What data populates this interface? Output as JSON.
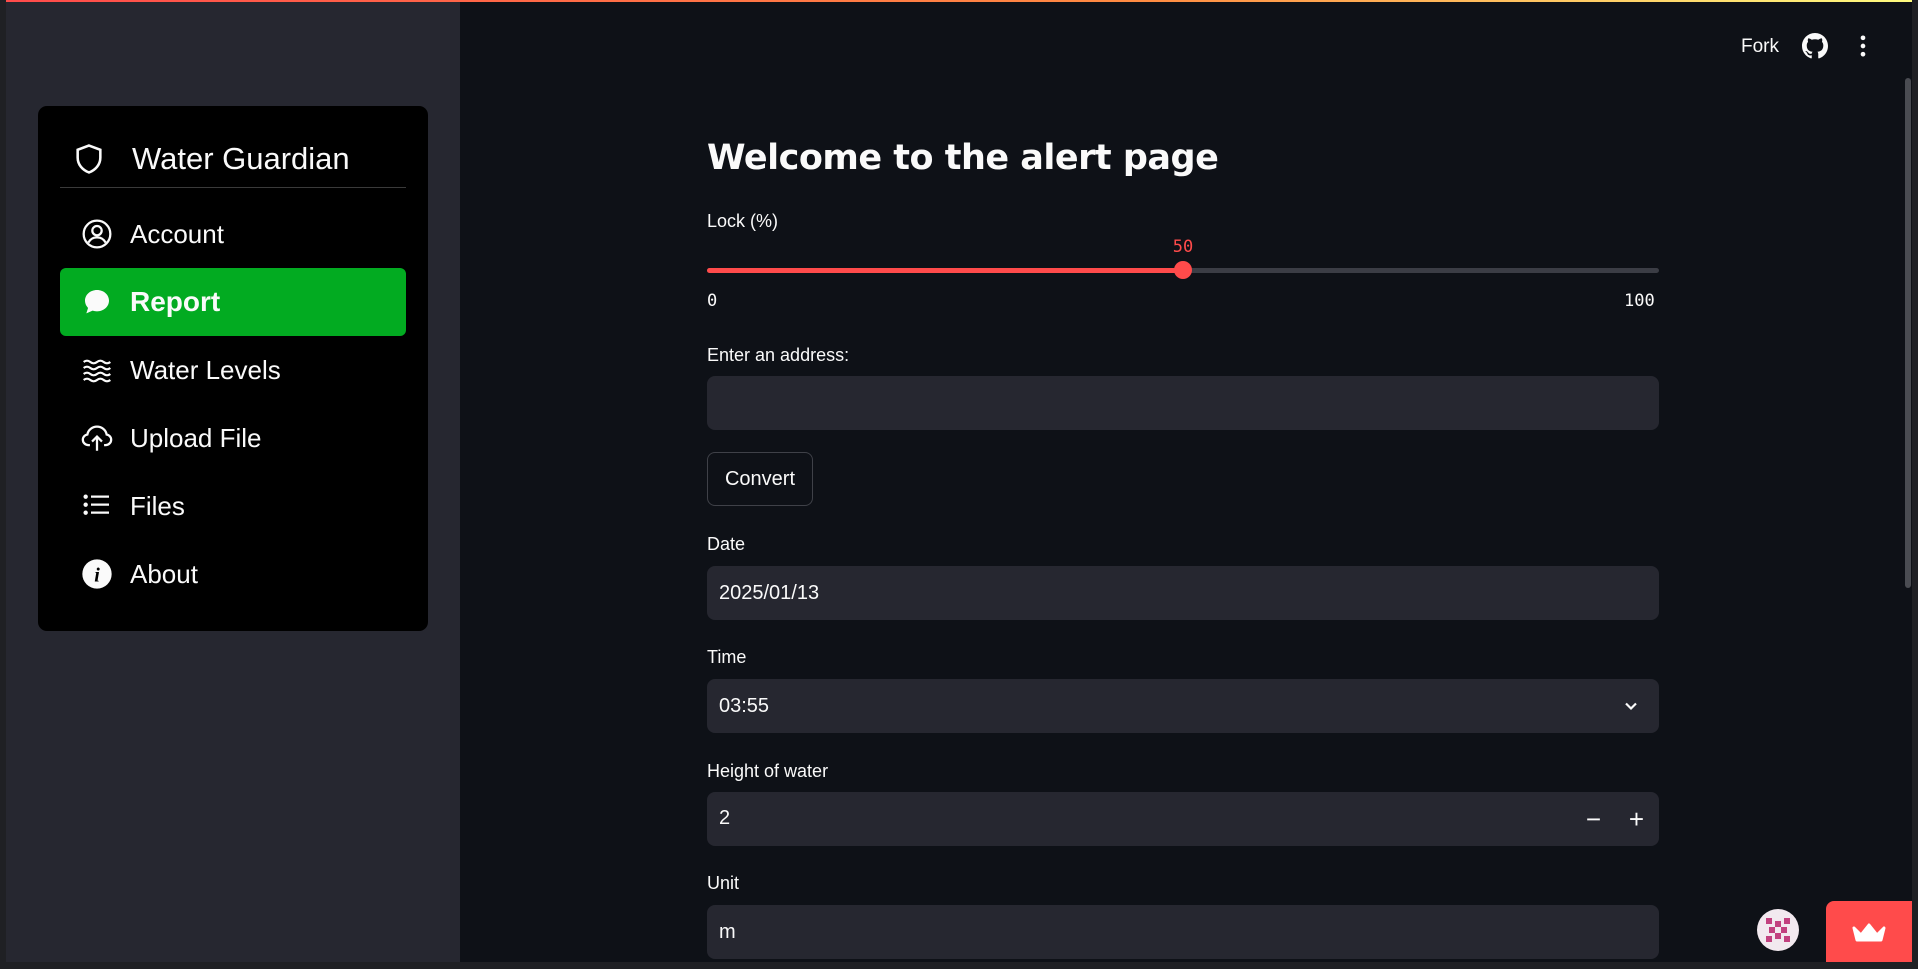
{
  "sidebar": {
    "title": "Water Guardian",
    "items": [
      {
        "label": "Account",
        "icon": "person-circle-icon",
        "active": false
      },
      {
        "label": "Report",
        "icon": "chat-bubble-icon",
        "active": true
      },
      {
        "label": "Water Levels",
        "icon": "water-waves-icon",
        "active": false
      },
      {
        "label": "Upload File",
        "icon": "cloud-upload-icon",
        "active": false
      },
      {
        "label": "Files",
        "icon": "list-icon",
        "active": false
      },
      {
        "label": "About",
        "icon": "info-circle-icon",
        "active": false
      }
    ],
    "accent_color": "#02ab21"
  },
  "header": {
    "fork_label": "Fork",
    "github_icon": "github-icon",
    "menu_icon": "more-vertical-icon"
  },
  "main": {
    "title": "Welcome to the alert page",
    "lock": {
      "label": "Lock (%)",
      "value": 50,
      "min": 0,
      "max": 100,
      "min_label": "0",
      "max_label": "100",
      "value_label": "50",
      "color": "#ff4b4b"
    },
    "address": {
      "label": "Enter an address:",
      "value": ""
    },
    "convert_label": "Convert",
    "date": {
      "label": "Date",
      "value": "2025/01/13"
    },
    "time": {
      "label": "Time",
      "value": "03:55"
    },
    "height": {
      "label": "Height of water",
      "value": "2",
      "minus": "−",
      "plus": "+"
    },
    "unit": {
      "label": "Unit",
      "value": "m"
    }
  }
}
